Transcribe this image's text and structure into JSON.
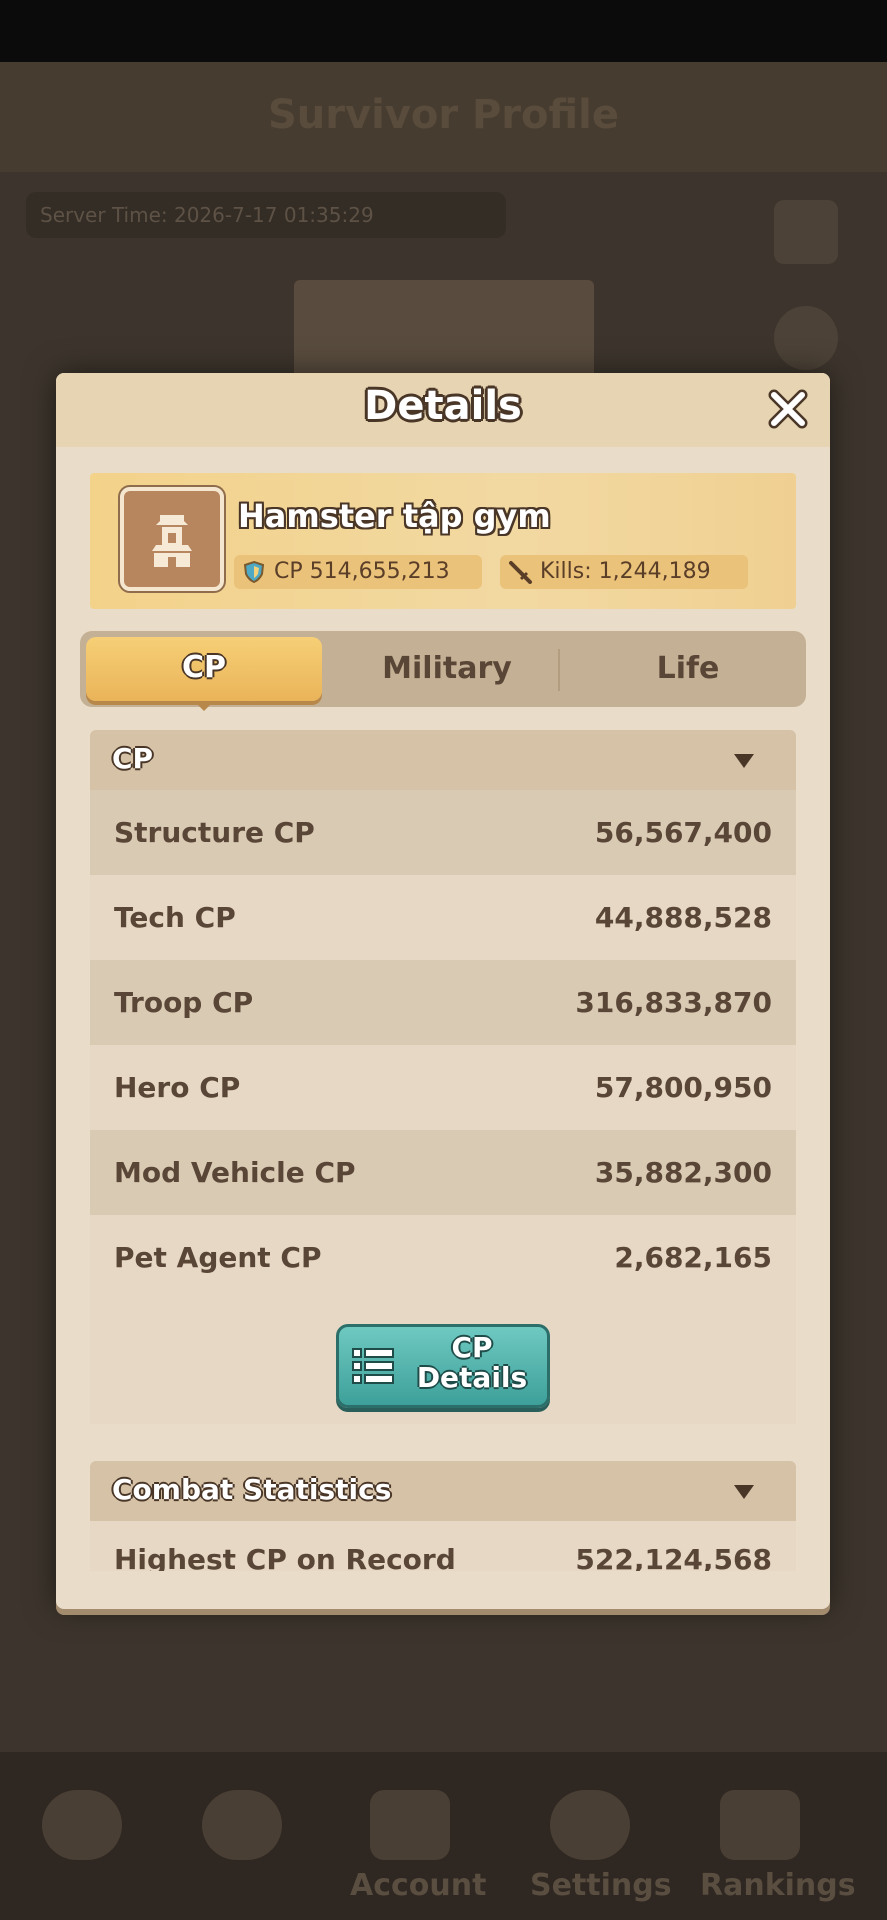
{
  "background": {
    "header_title": "Survivor Profile",
    "server_time": "Server Time: 2026-7-17 01:35:29",
    "nav": [
      "",
      "",
      "Account",
      "Settings",
      "Rankings"
    ]
  },
  "modal": {
    "title": "Details",
    "player": {
      "name": "Hamster tập gym",
      "cp": "CP 514,655,213",
      "kills_label": "Kills:",
      "kills_value": "1,244,189"
    },
    "tabs": {
      "cp": "CP",
      "military": "Military",
      "life": "Life"
    },
    "cp_section": {
      "title": "CP",
      "rows": [
        {
          "label": "Structure CP",
          "value": "56,567,400"
        },
        {
          "label": "Tech CP",
          "value": "44,888,528"
        },
        {
          "label": "Troop CP",
          "value": "316,833,870"
        },
        {
          "label": "Hero CP",
          "value": "57,800,950"
        },
        {
          "label": "Mod Vehicle CP",
          "value": "35,882,300"
        },
        {
          "label": "Pet Agent CP",
          "value": "2,682,165"
        }
      ],
      "details_button_line1": "CP",
      "details_button_line2": "Details"
    },
    "combat_section": {
      "title": "Combat Statistics",
      "rows": [
        {
          "label": "Highest CP on Record",
          "value": "522,124,568"
        }
      ]
    }
  },
  "colors": {
    "accent_tab": "#eab459",
    "button_teal": "#3ea09a",
    "text_brown": "#5a4636"
  }
}
